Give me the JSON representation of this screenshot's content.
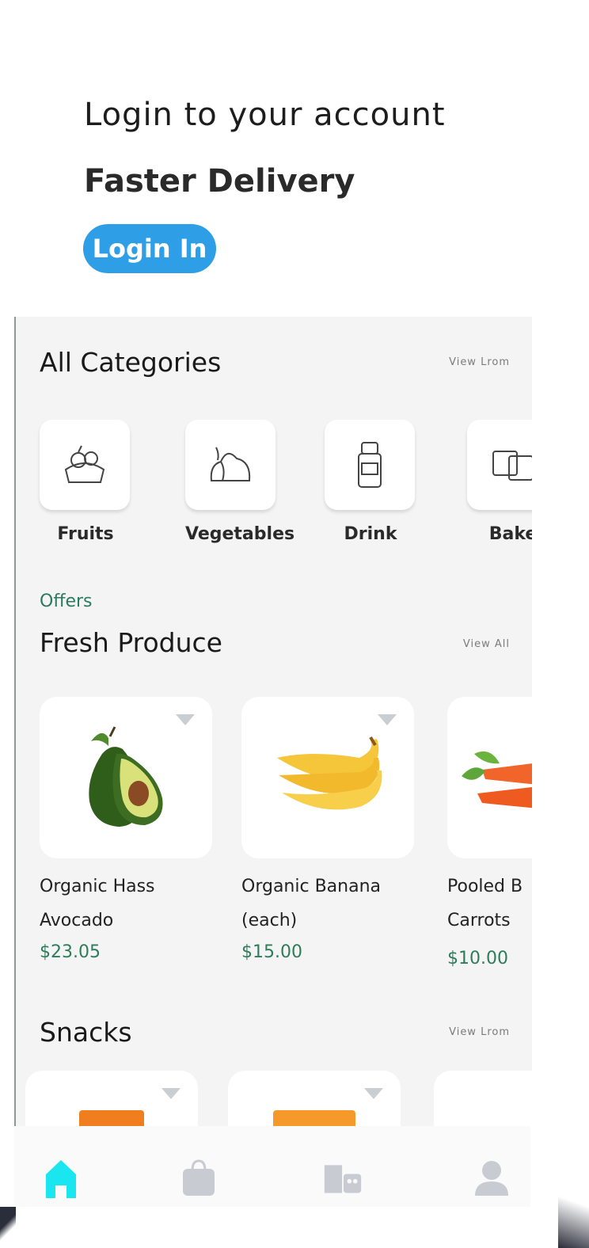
{
  "header": {
    "title": "Login to your account",
    "subtitle": "Faster Delivery",
    "login_button": "Login In",
    "accent": "#2e9ee6"
  },
  "categories": {
    "title": "All Categories",
    "view_all": "View Lrom",
    "items": [
      {
        "label": "Fruits",
        "icon": "fruit-basket-icon"
      },
      {
        "label": "Vegetables",
        "icon": "vegetables-icon"
      },
      {
        "label": "Drink",
        "icon": "drink-bottle-icon"
      },
      {
        "label": "Bake",
        "icon": "bakery-icon"
      }
    ]
  },
  "offers": {
    "label": "Offers",
    "title": "Fresh Produce",
    "view_all": "View All",
    "products": [
      {
        "name_line1": "Organic Hass",
        "name_line2": "Avocado",
        "price": "$23.05",
        "image": "avocado"
      },
      {
        "name_line1": "Organic Banana",
        "name_line2": "(each)",
        "price": "$15.00",
        "image": "banana"
      },
      {
        "name_line1": "Pooled B",
        "name_line2": "Carrots",
        "price": "$10.00",
        "image": "carrots"
      }
    ]
  },
  "snacks": {
    "title": "Snacks",
    "view_all": "View Lrom"
  },
  "bottom_nav": [
    {
      "name": "home",
      "icon": "home-icon",
      "active": true
    },
    {
      "name": "cart",
      "icon": "bag-icon",
      "active": false
    },
    {
      "name": "stores",
      "icon": "store-icon",
      "active": false
    },
    {
      "name": "profile",
      "icon": "user-icon",
      "active": false
    }
  ],
  "colors": {
    "price": "#2e7d5a",
    "active_nav": "#19e6ef",
    "inactive_nav": "#c8ccd2"
  }
}
